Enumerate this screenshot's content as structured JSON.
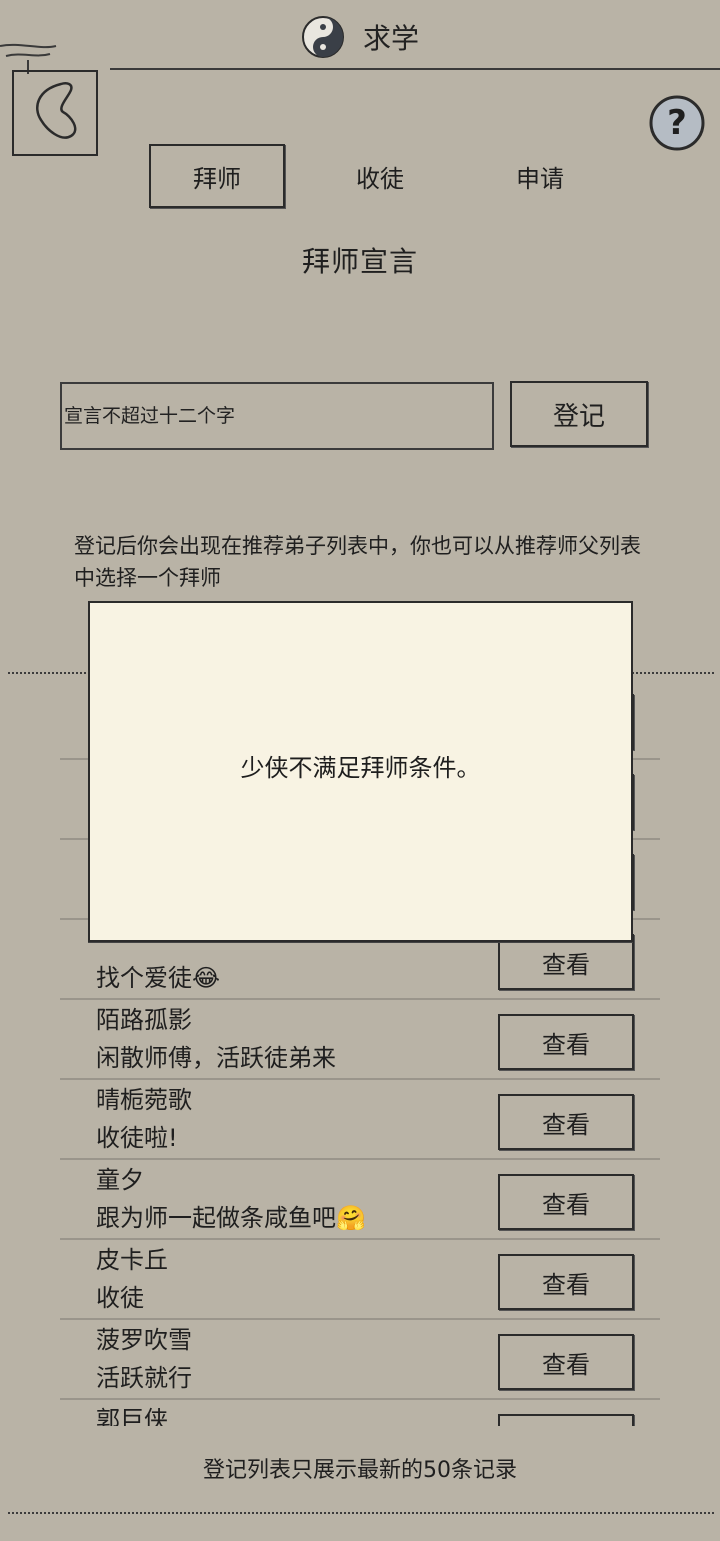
{
  "header": {
    "title": "求学",
    "logo_icon": "yin-yang-icon",
    "back_icon": "back-arrow-icon",
    "help_icon": "question-icon"
  },
  "tabs": [
    {
      "label": "拜师",
      "active": true
    },
    {
      "label": "收徒",
      "active": false
    },
    {
      "label": "申请",
      "active": false
    }
  ],
  "declaration": {
    "title": "拜师宣言",
    "placeholder": "宣言不超过十二个字",
    "register_label": "登记",
    "info": "登记后你会出现在推荐弟子列表中，你也可以从推荐师父列表中选择一个拜师"
  },
  "list": {
    "view_label": "查看",
    "rows": [
      {
        "name": "",
        "motto": "找个爱徒😂"
      },
      {
        "name": "陌路孤影",
        "motto": "闲散师傅，活跃徒弟来"
      },
      {
        "name": "晴栀菀歌",
        "motto": "收徒啦!"
      },
      {
        "name": "童夕",
        "motto": "跟为师一起做条咸鱼吧🤗"
      },
      {
        "name": "皮卡丘",
        "motto": "收徒"
      },
      {
        "name": "菠罗吹雪",
        "motto": "活跃就行"
      },
      {
        "name": "郭巨侠",
        "motto": ""
      }
    ],
    "footer_note": "登记列表只展示最新的50条记录"
  },
  "modal": {
    "message": "少侠不满足拜师条件。"
  },
  "colors": {
    "background": "#b9b3a6",
    "modal_bg": "#f8f3e3",
    "ink": "#1f1f1f"
  }
}
